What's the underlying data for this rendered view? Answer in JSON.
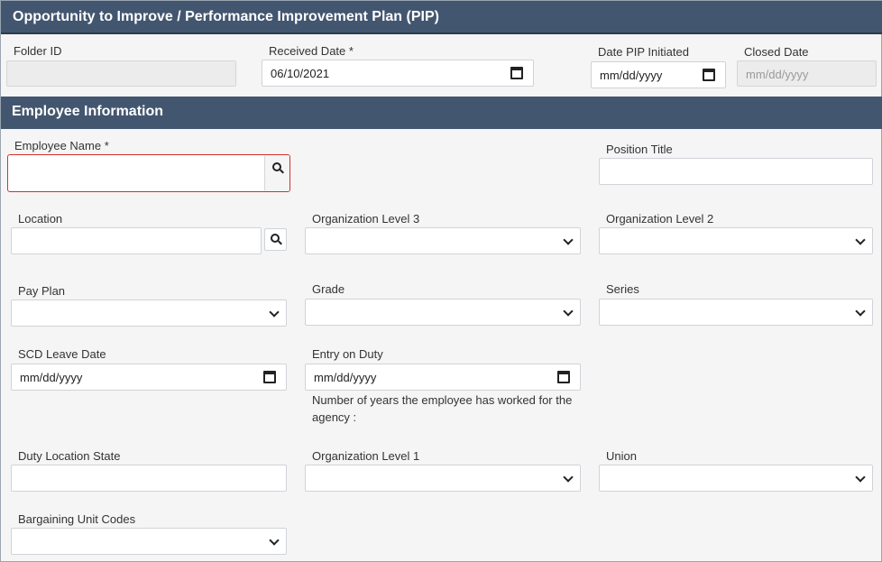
{
  "header": {
    "title": "Opportunity to Improve / Performance Improvement Plan (PIP)"
  },
  "top_fields": {
    "folder_id": {
      "label": "Folder ID",
      "value": ""
    },
    "received_date": {
      "label": "Received Date *",
      "value": "06/10/2021"
    },
    "date_pip_initiated": {
      "label": "Date PIP Initiated",
      "placeholder": "mm/dd/yyyy"
    },
    "closed_date": {
      "label": "Closed Date",
      "placeholder": "mm/dd/yyyy"
    }
  },
  "employee_section": {
    "title": "Employee Information",
    "employee_name": {
      "label": "Employee Name *",
      "value": ""
    },
    "position_title": {
      "label": "Position Title",
      "value": ""
    },
    "location": {
      "label": "Location",
      "value": ""
    },
    "org_level_3": {
      "label": "Organization Level 3",
      "selected": ""
    },
    "org_level_2": {
      "label": "Organization Level 2",
      "selected": ""
    },
    "pay_plan": {
      "label": "Pay Plan",
      "selected": ""
    },
    "grade": {
      "label": "Grade",
      "selected": ""
    },
    "series": {
      "label": "Series",
      "selected": ""
    },
    "scd_leave_date": {
      "label": "SCD Leave Date",
      "placeholder": "mm/dd/yyyy"
    },
    "entry_on_duty": {
      "label": "Entry on Duty",
      "placeholder": "mm/dd/yyyy"
    },
    "years_note": "Number of years the employee has worked for the agency :",
    "duty_location_state": {
      "label": "Duty Location State",
      "value": ""
    },
    "org_level_1": {
      "label": "Organization Level 1",
      "selected": ""
    },
    "union": {
      "label": "Union",
      "selected": ""
    },
    "bargaining_unit_codes": {
      "label": "Bargaining Unit Codes",
      "selected": ""
    }
  },
  "colors": {
    "header_band": "#435670",
    "error_border": "#d32f2f",
    "page_bg": "#f5f5f5"
  },
  "icons": {
    "search": "search-icon",
    "calendar": "calendar-icon",
    "dropdown": "chevron-down-icon"
  }
}
